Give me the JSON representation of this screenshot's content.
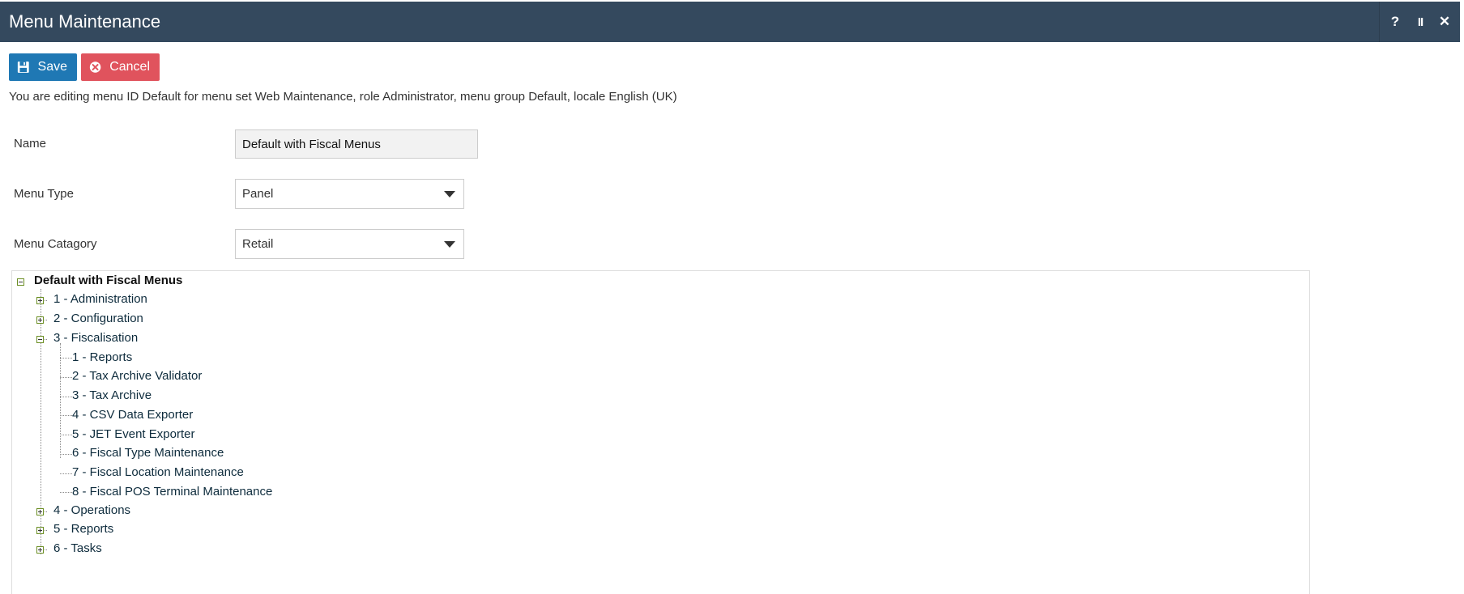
{
  "window": {
    "title": "Menu Maintenance",
    "help_label": "?",
    "pause_label": "II",
    "close_label": "✕"
  },
  "toolbar": {
    "save_label": "Save",
    "cancel_label": "Cancel",
    "save_icon": "floppy-disk-icon",
    "cancel_icon": "x-circle-icon"
  },
  "info_text": "You are editing menu ID Default for menu set Web Maintenance, role Administrator, menu group Default, locale English (UK)",
  "form": {
    "name_label": "Name",
    "name_value": "Default with Fiscal Menus",
    "menu_type_label": "Menu Type",
    "menu_type_value": "Panel",
    "menu_category_label": "Menu Catagory",
    "menu_category_value": "Retail"
  },
  "tree": {
    "root": "Default with Fiscal Menus",
    "items": [
      {
        "label": "1 - Administration",
        "expanded": false
      },
      {
        "label": "2 - Configuration",
        "expanded": false
      },
      {
        "label": "3 - Fiscalisation",
        "expanded": true
      },
      {
        "label": "4 - Operations",
        "expanded": false
      },
      {
        "label": "5 - Reports",
        "expanded": false
      },
      {
        "label": "6 - Tasks",
        "expanded": false
      }
    ],
    "fiscalisation_children": [
      "1 - Reports",
      "2 - Tax Archive Validator",
      "3 - Tax Archive",
      "4 - CSV Data Exporter",
      "5 - JET Event Exporter",
      "6 - Fiscal Type Maintenance",
      "7 - Fiscal Location Maintenance",
      "8 - Fiscal POS Terminal Maintenance"
    ]
  },
  "colors": {
    "titlebar": "#34495e",
    "save_button": "#1f78b4",
    "cancel_button": "#e0535d"
  }
}
